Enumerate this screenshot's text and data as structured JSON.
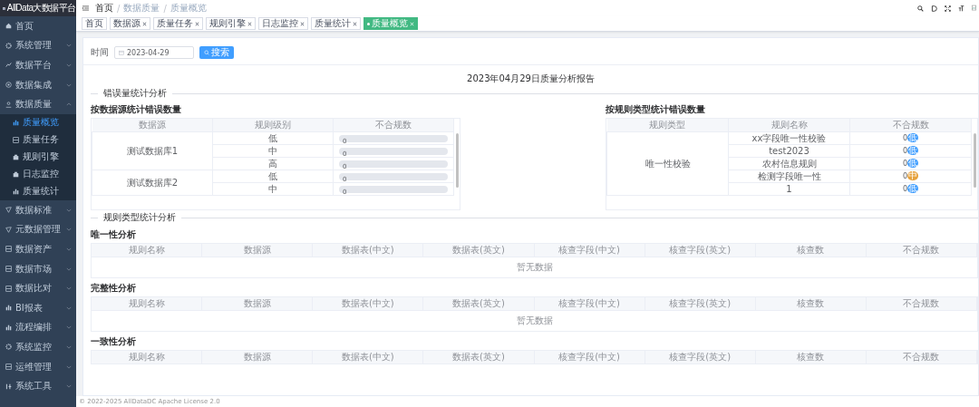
{
  "app": {
    "title": "AllData大数据平台"
  },
  "sidebar": {
    "items": [
      {
        "label": "首页"
      },
      {
        "label": "系统管理",
        "expanded": false
      },
      {
        "label": "数据平台",
        "expanded": false
      },
      {
        "label": "数据集成",
        "expanded": false
      },
      {
        "label": "数据质量",
        "expanded": true,
        "children": [
          {
            "label": "质量概览",
            "selected": true
          },
          {
            "label": "质量任务",
            "selected": false
          },
          {
            "label": "规则引擎",
            "selected": false
          },
          {
            "label": "日志监控",
            "selected": false
          },
          {
            "label": "质量统计",
            "selected": false
          }
        ]
      },
      {
        "label": "数据标准",
        "expanded": false
      },
      {
        "label": "元数据管理",
        "expanded": false
      },
      {
        "label": "数据资产",
        "expanded": false
      },
      {
        "label": "数据市场",
        "expanded": false
      },
      {
        "label": "数据比对",
        "expanded": false
      },
      {
        "label": "BI报表",
        "expanded": false
      },
      {
        "label": "流程编排",
        "expanded": false
      },
      {
        "label": "系统监控",
        "expanded": false
      },
      {
        "label": "运维管理",
        "expanded": false
      },
      {
        "label": "系统工具",
        "expanded": false
      }
    ]
  },
  "breadcrumb": {
    "separator": "/",
    "items": [
      "首页",
      "数据质量",
      "质量概览"
    ]
  },
  "tabs": [
    {
      "label": "首页",
      "closable": false,
      "selected": false
    },
    {
      "label": "数据源",
      "closable": true,
      "selected": false
    },
    {
      "label": "质量任务",
      "closable": true,
      "selected": false
    },
    {
      "label": "规则引擎",
      "closable": true,
      "selected": false
    },
    {
      "label": "日志监控",
      "closable": true,
      "selected": false
    },
    {
      "label": "质量统计",
      "closable": true,
      "selected": false
    },
    {
      "label": "质量概览",
      "closable": true,
      "selected": true
    }
  ],
  "search": {
    "label": "时间",
    "value": "2023-04-29",
    "button": "搜索"
  },
  "report_title": "2023年04月29日质量分析报告",
  "error_section": {
    "title": "错误量统计分析",
    "by_source": {
      "title": "按数据源统计错误数量",
      "columns": [
        "数据源",
        "规则级别",
        "不合规数"
      ],
      "groups": [
        {
          "source": "测试数据库1",
          "rows": [
            {
              "level_name": "低",
              "count": "0",
              "level": 0
            },
            {
              "level_name": "中",
              "count": "0",
              "level": 0
            },
            {
              "level_name": "高",
              "count": "0",
              "level": 0
            }
          ]
        },
        {
          "source": "测试数据库2",
          "rows": [
            {
              "level_name": "低",
              "count": "0",
              "level": 0
            },
            {
              "level_name": "中",
              "count": "0",
              "level": 0
            }
          ]
        }
      ]
    },
    "by_rule_type": {
      "title": "按规则类型统计错误数量",
      "columns": [
        "规则类型",
        "规则名称",
        "不合规数"
      ],
      "groups": [
        {
          "type": "唯一性校验",
          "rows": [
            {
              "name": "xx字段唯一性校验",
              "count": "0",
              "badge": "低",
              "color": "#409eff"
            },
            {
              "name": "test2023",
              "count": "0",
              "badge": "低",
              "color": "#409eff"
            },
            {
              "name": "农村信息规则",
              "count": "0",
              "badge": "低",
              "color": "#409eff"
            },
            {
              "name": "检测字段唯一性",
              "count": "0",
              "badge": "中",
              "color": "#e6a23c"
            },
            {
              "name": "1",
              "count": "0",
              "badge": "低",
              "color": "#409eff"
            }
          ]
        }
      ]
    }
  },
  "rule_section": {
    "title": "规则类型统计分析",
    "tables": [
      {
        "title": "唯一性分析",
        "columns": [
          "规则名称",
          "数据源",
          "数据表(中文)",
          "数据表(英文)",
          "核查字段(中文)",
          "核查字段(英文)",
          "核查数",
          "不合规数"
        ],
        "empty_text": "暂无数据"
      },
      {
        "title": "完整性分析",
        "columns": [
          "规则名称",
          "数据源",
          "数据表(中文)",
          "数据表(英文)",
          "核查字段(中文)",
          "核查字段(英文)",
          "核查数",
          "不合规数"
        ],
        "empty_text": "暂无数据"
      },
      {
        "title": "一致性分析",
        "columns": [
          "规则名称",
          "数据源",
          "数据表(中文)",
          "数据表(英文)",
          "核查字段(中文)",
          "核查字段(英文)",
          "核查数",
          "不合规数"
        ]
      }
    ]
  },
  "footer": "© 2022-2025 AllDataDC Apache License 2.0"
}
